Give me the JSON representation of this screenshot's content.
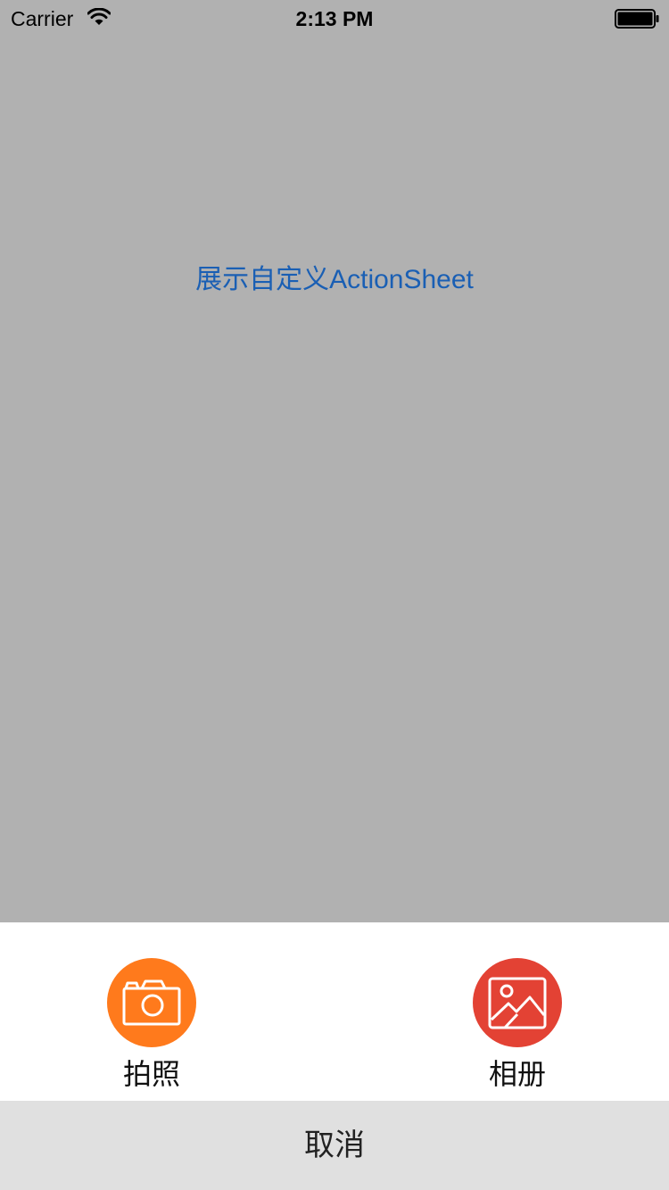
{
  "status_bar": {
    "carrier": "Carrier",
    "time": "2:13 PM"
  },
  "main": {
    "trigger_label": "展示自定义ActionSheet",
    "link_color": "#1a5fb4"
  },
  "action_sheet": {
    "options": [
      {
        "label": "拍照",
        "icon": "camera-icon",
        "color": "#ff7a1c"
      },
      {
        "label": "相册",
        "icon": "image-icon",
        "color": "#e34234"
      }
    ],
    "cancel_label": "取消"
  }
}
